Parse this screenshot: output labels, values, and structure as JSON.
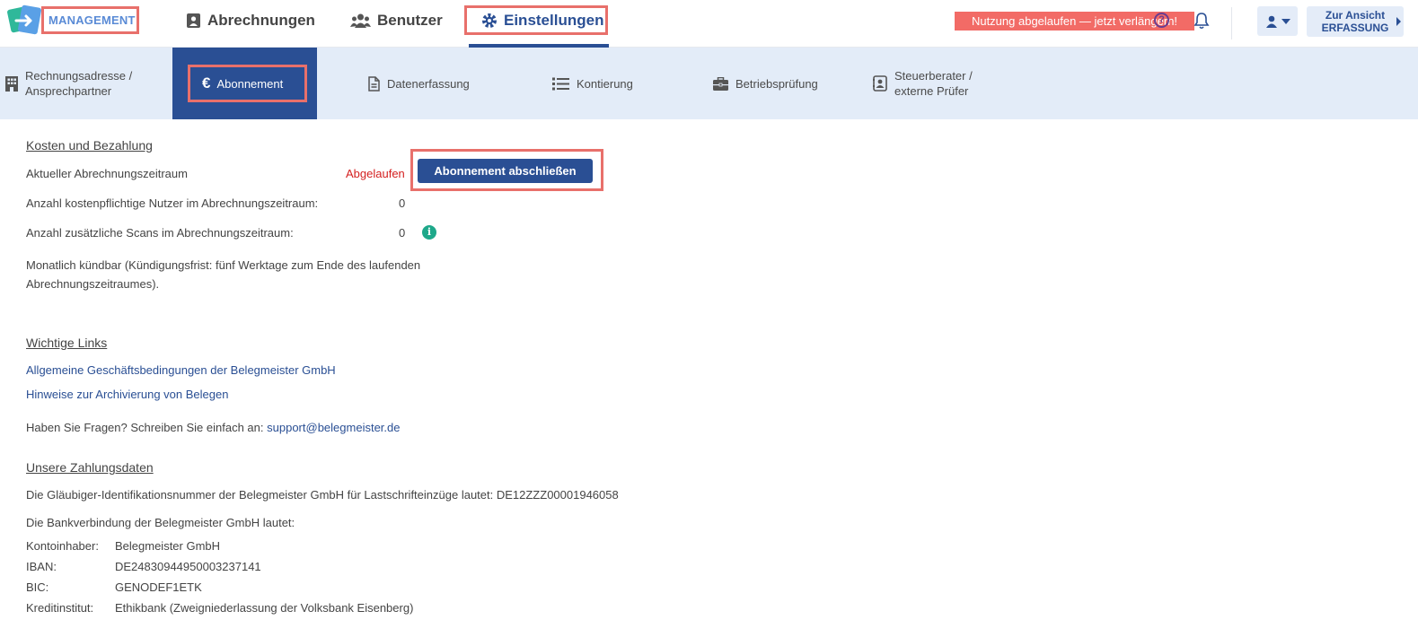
{
  "topbar": {
    "brand": "MANAGEMENT",
    "nav": {
      "abrechnungen": "Abrechnungen",
      "benutzer": "Benutzer",
      "einstellungen": "Einstellungen"
    },
    "expired_banner": "Nutzung abgelaufen — jetzt verlängern!",
    "view_button_line1": "Zur Ansicht",
    "view_button_line2": "ERFASSUNG"
  },
  "subnav": {
    "rechnungsadresse_l1": "Rechnungsadresse /",
    "rechnungsadresse_l2": "Ansprechpartner",
    "abonnement": "Abonnement",
    "datenerfassung": "Datenerfassung",
    "kontierung": "Kontierung",
    "betriebspruefung": "Betriebsprüfung",
    "steuerberater_l1": "Steuerberater /",
    "steuerberater_l2": "externe Prüfer"
  },
  "costs": {
    "title": "Kosten und Bezahlung",
    "period_label": "Aktueller Abrechnungszeitraum",
    "period_status": "Abgelaufen",
    "subscribe_button": "Abonnement abschließen",
    "users_label": "Anzahl kostenpflichtige Nutzer im Abrechnungszeitraum:",
    "users_value": "0",
    "scans_label": "Anzahl zusätzliche Scans im Abrechnungszeitraum:",
    "scans_value": "0",
    "cancel_line1": "Monatlich kündbar (Kündigungsfrist: fünf Werktage zum Ende des laufenden",
    "cancel_line2": "Abrechnungszeitraumes)."
  },
  "links": {
    "title": "Wichtige Links",
    "agb": "Allgemeine Geschäftsbedingungen der Belegmeister GmbH",
    "archiv": "Hinweise zur Archivierung von Belegen",
    "questions_text": "Haben Sie Fragen? Schreiben Sie einfach an:",
    "support_email": "support@belegmeister.de"
  },
  "payment": {
    "title": "Unsere Zahlungsdaten",
    "creditor_text": "Die Gläubiger-Identifikationsnummer der Belegmeister GmbH für Lastschrifteinzüge lautet: DE12ZZZ00001946058",
    "bank_intro": "Die Bankverbindung der Belegmeister GmbH lautet:",
    "rows": [
      {
        "key": "Kontoinhaber:",
        "value": "Belegmeister GmbH"
      },
      {
        "key": "IBAN:",
        "value": "DE24830944950003237141"
      },
      {
        "key": "BIC:",
        "value": "GENODEF1ETK"
      },
      {
        "key": "Kreditinstitut:",
        "value": "Ethikbank (Zweigniederlassung der Volksbank Eisenberg)"
      }
    ]
  },
  "colors": {
    "primary": "#2a4f94",
    "subnav_bg": "#e3ecf8",
    "highlight_border": "#e8706b",
    "banner": "#f26b66",
    "expired_text": "#d42020",
    "info": "#1ea88a"
  },
  "icons": [
    "app-logo-icon",
    "calculator-icon",
    "users-icon",
    "gear-icon",
    "help-icon",
    "bell-icon",
    "user-icon",
    "chevron-down-icon",
    "building-icon",
    "euro-icon",
    "document-icon",
    "list-icon",
    "briefcase-icon",
    "contact-card-icon",
    "info-icon"
  ]
}
